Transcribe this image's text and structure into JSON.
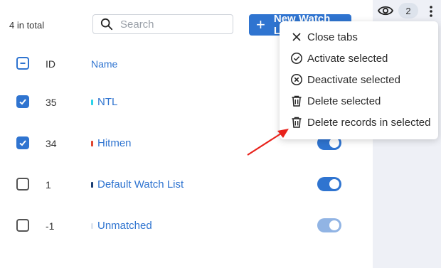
{
  "header": {
    "total_text": "4 in total",
    "search_placeholder": "Search",
    "new_button_label": "New Watch List",
    "badge_count": "2"
  },
  "table": {
    "columns": {
      "id": "ID",
      "name": "Name"
    },
    "rows": [
      {
        "checked": true,
        "id": "35",
        "name": "NTL",
        "color": "#2ad3e8",
        "enabled": true
      },
      {
        "checked": true,
        "id": "34",
        "name": "Hitmen",
        "color": "#e0452f",
        "enabled": true
      },
      {
        "checked": false,
        "id": "1",
        "name": "Default Watch List",
        "color": "#1a3d73",
        "enabled": true
      },
      {
        "checked": false,
        "id": "-1",
        "name": "Unmatched",
        "color": "#dfe6ef",
        "enabled": true,
        "dim": true
      }
    ]
  },
  "menu": {
    "items": [
      {
        "label": "Close tabs",
        "icon": "close-icon"
      },
      {
        "label": "Activate selected",
        "icon": "check-circle-icon"
      },
      {
        "label": "Deactivate selected",
        "icon": "x-circle-icon"
      },
      {
        "label": "Delete selected",
        "icon": "trash-icon"
      },
      {
        "label": "Delete records in selected",
        "icon": "trash-icon"
      }
    ]
  },
  "colors": {
    "accent": "#2f74d0",
    "annotation_arrow": "#e8221b"
  }
}
